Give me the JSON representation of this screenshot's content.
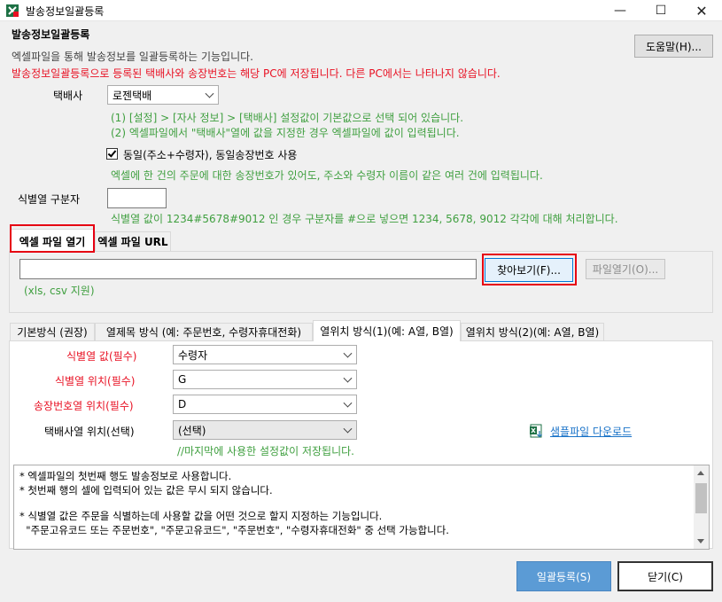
{
  "window": {
    "title": "발송정보일괄등록",
    "minimize_glyph": "—",
    "maximize_glyph": "☐",
    "close_glyph": "✕"
  },
  "header": {
    "title": "발송정보일괄등록",
    "description": "엑셀파일을 통해 발송정보를 일괄등록하는 기능입니다.",
    "warning": "발송정보일괄등록으로 등록된 택배사와 송장번호는 해당 PC에 저장됩니다. 다른 PC에서는 나타나지 않습니다.",
    "help_button": "도움말(H)..."
  },
  "courier": {
    "label": "택배사",
    "value": "로젠택배",
    "hint1": "(1) [설정] > [자사 정보] > [택배사] 설정값이 기본값으로 선택 되어 있습니다.",
    "hint2": "(2) 엑셀파일에서 \"택배사\"열에 값을 지정한 경우 엑셀파일에 값이 입력됩니다."
  },
  "same_invoice": {
    "checked": true,
    "label": "동일(주소+수령자), 동일송장번호 사용",
    "hint": "엑셀에 한 건의 주문에 대한 송장번호가 있어도, 주소와 수령자 이름이 같은 여러 건에 입력됩니다."
  },
  "separator": {
    "label": "식별열 구분자",
    "value": "",
    "hint": "식별열 값이 1234#5678#9012 인 경우 구분자를 #으로 넣으면 1234, 5678, 9012 각각에 대해 처리합니다."
  },
  "file_tabs": {
    "tab_open": "엑셀 파일 열기",
    "tab_url": "엑셀 파일 URL",
    "path_value": "",
    "browse_button": "찾아보기(F)...",
    "open_button": "파일열기(O)...",
    "supported": "(xls, csv 지원)"
  },
  "mode_tabs": {
    "tab1": "기본방식 (권장)",
    "tab2": "열제목 방식 (예: 주문번호, 수령자휴대전화)",
    "tab3": "열위치 방식(1)(예: A열, B열)",
    "tab4": "열위치 방식(2)(예: A열, B열)"
  },
  "fields": {
    "id_value_label": "식별열 값(필수)",
    "id_value": "수령자",
    "id_pos_label": "식별열 위치(필수)",
    "id_pos": "G",
    "invoice_pos_label": "송장번호열 위치(필수)",
    "invoice_pos": "D",
    "courier_pos_label": "택배사열 위치(선택)",
    "courier_pos": "(선택)",
    "saved_note": "//마지막에 사용한 설정값이 저장됩니다.",
    "sample_link": "샘플파일 다운로드"
  },
  "notes": {
    "line1": "* 엑셀파일의 첫번째 행도 발송정보로 사용합니다.",
    "line2": "* 첫번째 행의 셀에 입력되어 있는 값은 무시 되지 않습니다.",
    "line3": "* 식별열 값은 주문을 식별하는데 사용할 값을 어떤 것으로 할지 지정하는 기능입니다.",
    "line4": "  \"주문고유코드 또는 주문번호\", \"주문고유코드\", \"주문번호\", \"수령자휴대전화\" 중 선택 가능합니다."
  },
  "footer": {
    "submit_button": "일괄등록(S)",
    "close_button": "닫기(C)"
  },
  "colors": {
    "warning_red": "#e81123",
    "hint_green": "#3f9f3f",
    "primary_button": "#5b9bd5",
    "highlight_red": "#e60012",
    "link_blue": "#1a73c8"
  }
}
